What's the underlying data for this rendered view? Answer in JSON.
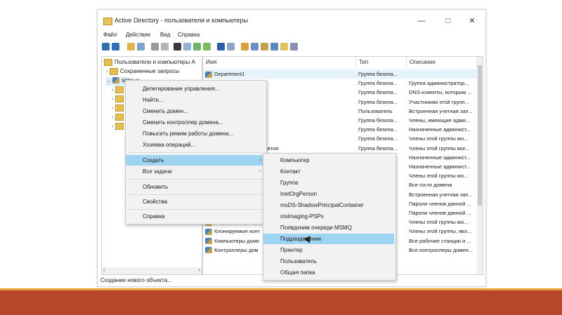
{
  "window": {
    "title": "Active Directory - пользователи и компьютеры",
    "minimize": "—",
    "maximize": "□",
    "close": "✕"
  },
  "menubar": [
    "Файл",
    "Действие",
    "Вид",
    "Справка"
  ],
  "tree": {
    "root": "Пользователи и компьютеры A",
    "saved_queries": "Сохраненные запросы",
    "domain": "sigro.ru"
  },
  "list": {
    "columns": [
      "Имя",
      "Тип",
      "Описание"
    ],
    "rows": [
      {
        "name": "Department1",
        "type": "Группа безопа...",
        "desc": ""
      },
      {
        "name": "",
        "type": "Группа безопа...",
        "desc": "Группа администратор..."
      },
      {
        "name": "",
        "type": "Группа безопа...",
        "desc": "DNS-клиенты, которым ..."
      },
      {
        "name": "",
        "type": "Группа безопа...",
        "desc": "Участникам этой групп..."
      },
      {
        "name": "",
        "type": "Пользователь",
        "desc": "Встроенная учетная зап..."
      },
      {
        "name": "HCP",
        "type": "Группа безопа...",
        "desc": "Члены, имеющие адми..."
      },
      {
        "name": "омена",
        "type": "Группа безопа...",
        "desc": "Назначенные админист..."
      },
      {
        "name": "сновного уровня",
        "type": "Группа безопа...",
        "desc": "Члены этой группы мо..."
      },
      {
        "name": "сновного уровня предприятия",
        "type": "Группа безопа...",
        "desc": "Члены этой группы мог..."
      },
      {
        "name": "",
        "type": "",
        "desc": "Назначенные админист..."
      },
      {
        "name": "",
        "type": "",
        "desc": "Назначенные админист..."
      },
      {
        "name": "",
        "type": "",
        "desc": "Члены этой группы мо..."
      },
      {
        "name": "",
        "type": "",
        "desc": "Все гости домена"
      },
      {
        "name": "",
        "type": "",
        "desc": "Встроенная учетная зап..."
      },
      {
        "name": "",
        "type": "",
        "desc": "Пароли членов данной ..."
      },
      {
        "name": "",
        "type": "",
        "desc": "Пароли членов данной ..."
      },
      {
        "name": "Издатели сертиф",
        "type": "",
        "desc": "Члены этой группы мо..."
      },
      {
        "name": "Клонируемые конт",
        "type": "",
        "desc": "Члены этой группы, явл..."
      },
      {
        "name": "Компьютеры доме",
        "type": "",
        "desc": "Все рабочие станции и ..."
      },
      {
        "name": "Контроллеры дом",
        "type": "",
        "desc": "Все контроллеры домен..."
      }
    ]
  },
  "context_menu": [
    {
      "label": "Делегирование управления..."
    },
    {
      "label": "Найти..."
    },
    {
      "label": "Сменить домен..."
    },
    {
      "label": "Сменить контроллер домена..."
    },
    {
      "label": "Повысить режим работы домена..."
    },
    {
      "label": "Хозяева операций..."
    },
    {
      "label": "Создать",
      "has_submenu": true,
      "highlighted": true
    },
    {
      "label": "Все задачи",
      "has_submenu": true
    },
    {
      "label": "Обновить"
    },
    {
      "label": "Свойства"
    },
    {
      "label": "Справка"
    }
  ],
  "submenu": [
    {
      "label": "Компьютер"
    },
    {
      "label": "Контакт"
    },
    {
      "label": "Группа"
    },
    {
      "label": "InetOrgPerson"
    },
    {
      "label": "msDS-ShadowPrincipalContainer"
    },
    {
      "label": "msImaging-PSPs"
    },
    {
      "label": "Псевдоним очереди MSMQ"
    },
    {
      "label": "Подразделение",
      "highlighted": true
    },
    {
      "label": "Принтер"
    },
    {
      "label": "Пользователь"
    },
    {
      "label": "Общая папка"
    }
  ],
  "status": "Создание нового объекта...",
  "colors": {
    "highlight": "#9fd3f2",
    "footer": "#b7472a",
    "footer_line": "#e7a33c"
  }
}
